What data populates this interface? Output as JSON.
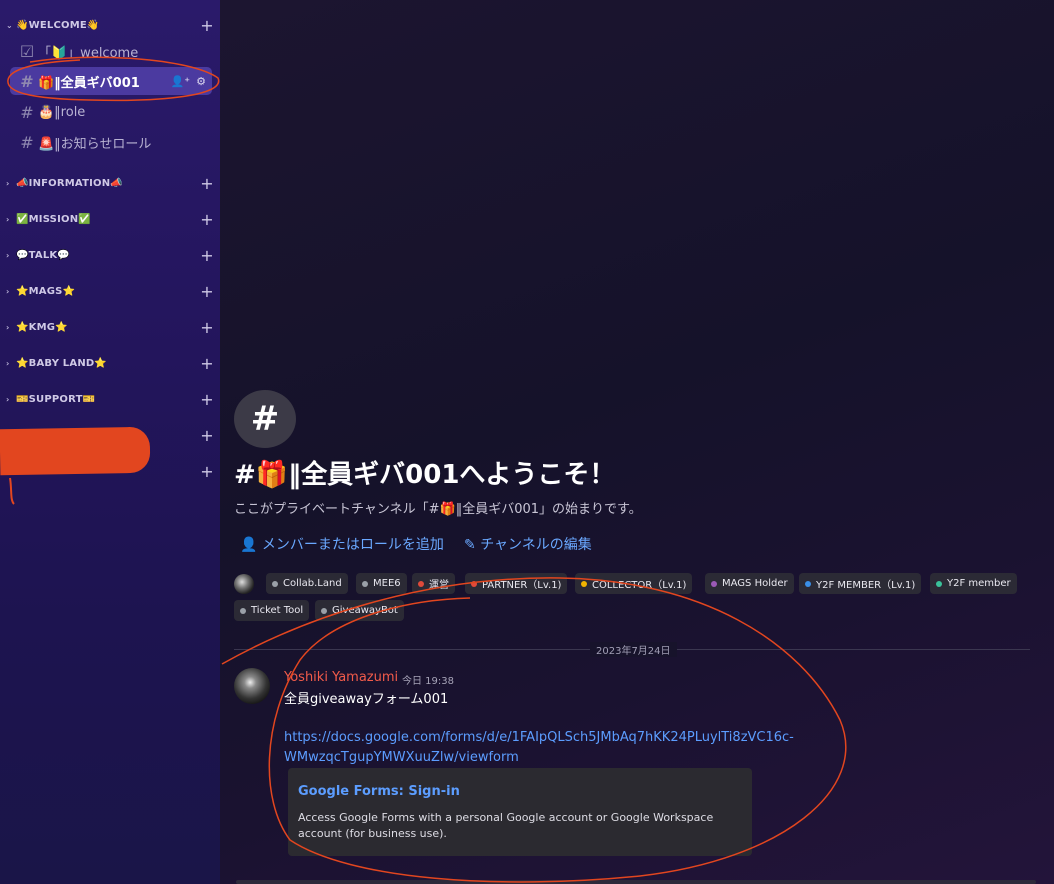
{
  "sidebar": {
    "categories": [
      {
        "name": "👋WELCOME👋",
        "chev": "⌄"
      },
      {
        "name": "📣INFORMATION📣",
        "chev": "›"
      },
      {
        "name": "✅MISSION✅",
        "chev": "›"
      },
      {
        "name": "💬TALK💬",
        "chev": "›"
      },
      {
        "name": "⭐MAGS⭐",
        "chev": "›"
      },
      {
        "name": "⭐KMG⭐",
        "chev": "›"
      },
      {
        "name": "⭐BABY LAND⭐",
        "chev": "›"
      },
      {
        "name": "🎫SUPPORT🎫",
        "chev": "›"
      }
    ],
    "channels": [
      {
        "label": "「🔰」welcome",
        "icon": "☑"
      },
      {
        "label": "🎁‖全員ギバ001",
        "icon": "#"
      },
      {
        "label": "🎂‖role",
        "icon": "#"
      },
      {
        "label": "🚨‖お知らせロール",
        "icon": "#"
      }
    ],
    "plus": "+",
    "active_actions": {
      "add": "👤⁺",
      "gear": "⚙"
    }
  },
  "main": {
    "channel_icon": "#",
    "title": "#🎁‖全員ギバ001へようこそ！",
    "subtitle": "ここがプライベートチャンネル「#🎁‖全員ギバ001」の始まりです。",
    "add_members": "メンバーまたはロールを追加",
    "edit_channel": "チャンネルの編集",
    "roles": [
      {
        "name": "Collab.Land",
        "color": "#9aa0a8"
      },
      {
        "name": "MEE6",
        "color": "#9aa0a8"
      },
      {
        "name": "運営",
        "color": "#e04a3a"
      },
      {
        "name": "PARTNER（Lv.1)",
        "color": "#e04a3a"
      },
      {
        "name": "COLLECTOR（Lv.1)",
        "color": "#f0b400"
      },
      {
        "name": "MAGS Holder",
        "color": "#9b59b6"
      },
      {
        "name": "Y2F MEMBER（Lv.1)",
        "color": "#3a8ee6"
      },
      {
        "name": "Y2F member",
        "color": "#3ac29a"
      },
      {
        "name": "Ticket Tool",
        "color": "#9aa0a8"
      },
      {
        "name": "GiveawayBot",
        "color": "#9aa0a8"
      }
    ],
    "date_divider": "2023年7月24日",
    "message": {
      "author": "Yoshiki Yamazumi",
      "timestamp": "今日 19:38",
      "text": "全員giveawayフォーム001",
      "link": "https://docs.google.com/forms/d/e/1FAIpQLSch5JMbAq7hKK24PLuylTi8zVC16c-WMwzqcTgupYMWXuuZlw/viewform",
      "embed": {
        "title": "Google Forms: Sign-in",
        "description": "Access Google Forms with a personal Google account or Google Workspace account (for business use)."
      }
    }
  }
}
